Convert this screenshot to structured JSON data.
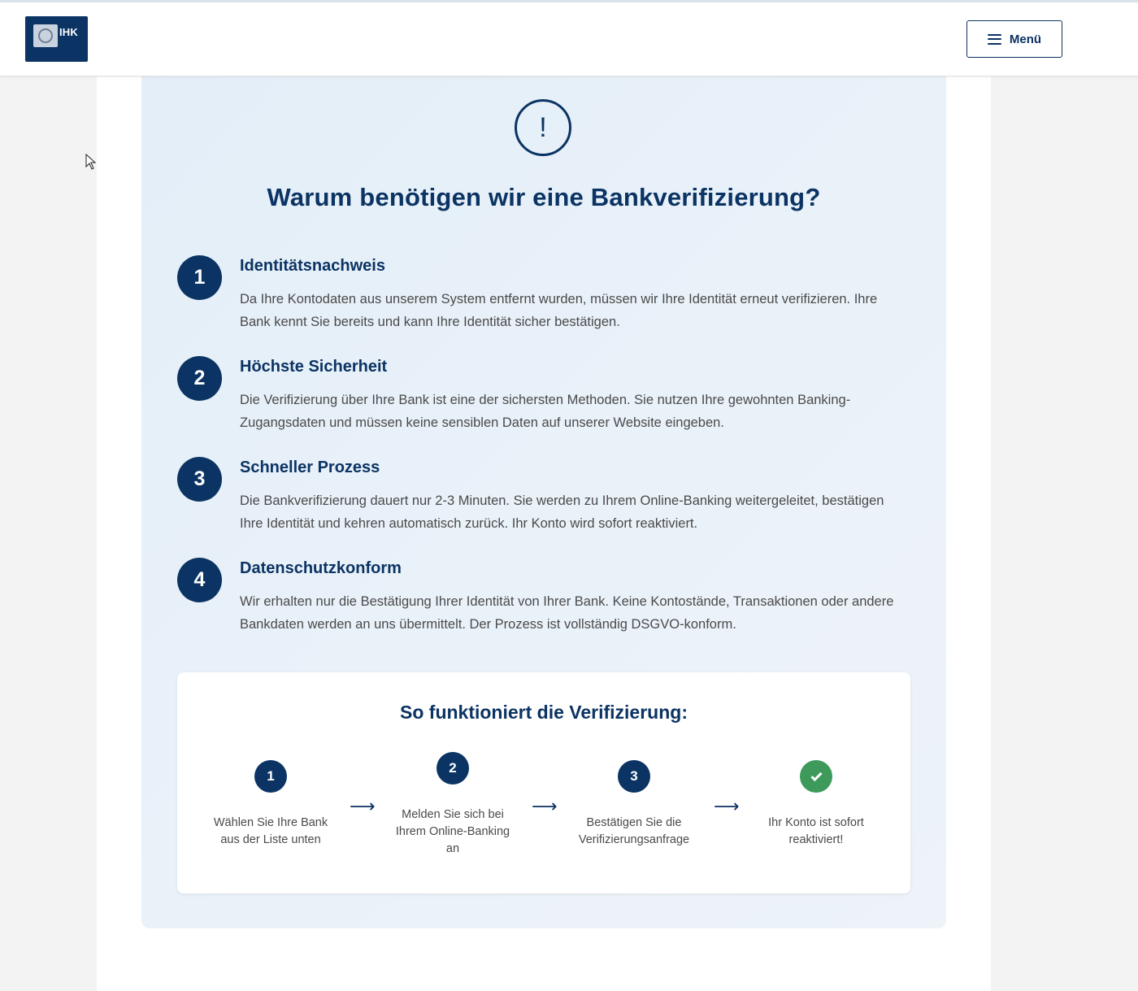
{
  "header": {
    "logo_text": "IHK",
    "menu_label": "Menü"
  },
  "main": {
    "title": "Warum benötigen wir eine Bankverifizierung?",
    "alert_symbol": "!",
    "reasons": [
      {
        "number": "1",
        "title": "Identitätsnachweis",
        "text": "Da Ihre Kontodaten aus unserem System entfernt wurden, müssen wir Ihre Identität erneut verifizieren. Ihre Bank kennt Sie bereits und kann Ihre Identität sicher bestätigen."
      },
      {
        "number": "2",
        "title": "Höchste Sicherheit",
        "text": "Die Verifizierung über Ihre Bank ist eine der sichersten Methoden. Sie nutzen Ihre gewohnten Banking-Zugangsdaten und müssen keine sensiblen Daten auf unserer Website eingeben."
      },
      {
        "number": "3",
        "title": "Schneller Prozess",
        "text": "Die Bankverifizierung dauert nur 2-3 Minuten. Sie werden zu Ihrem Online-Banking weitergeleitet, bestätigen Ihre Identität und kehren automatisch zurück. Ihr Konto wird sofort reaktiviert."
      },
      {
        "number": "4",
        "title": "Datenschutzkonform",
        "text": "Wir erhalten nur die Bestätigung Ihrer Identität von Ihrer Bank. Keine Kontostände, Transaktionen oder andere Bankdaten werden an uns übermittelt. Der Prozess ist vollständig DSGVO-konform."
      }
    ],
    "howto": {
      "title": "So funktioniert die Verifizierung:",
      "arrow": "⟶",
      "steps": [
        {
          "number": "1",
          "text": "Wählen Sie Ihre Bank aus der Liste unten"
        },
        {
          "number": "2",
          "text": "Melden Sie sich bei Ihrem Online-Banking an"
        },
        {
          "number": "3",
          "text": "Bestätigen Sie die Verifizierungsanfrage"
        },
        {
          "number": "",
          "icon": "check-icon",
          "text": "Ihr Konto ist sofort reaktiviert!"
        }
      ]
    }
  },
  "colors": {
    "brand_navy": "#0b3363",
    "success_green": "#3d9a5b",
    "panel_bg": "#e3eef8"
  }
}
